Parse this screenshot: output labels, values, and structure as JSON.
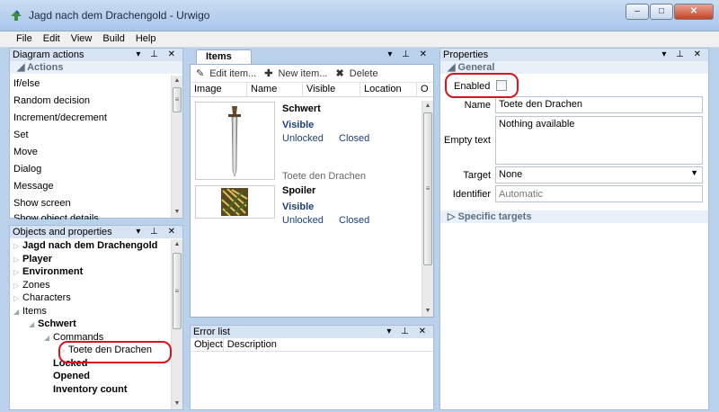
{
  "window": {
    "title": "Jagd nach dem Drachengold - Urwigo",
    "minimize": "–",
    "maximize": "□",
    "close": "✕"
  },
  "menu": [
    "File",
    "Edit",
    "View",
    "Build",
    "Help"
  ],
  "diagram_actions": {
    "title": "Diagram actions",
    "section": "Actions",
    "items": [
      "If/else",
      "Random decision",
      "Increment/decrement",
      "Set",
      "Move",
      "Dialog",
      "Message",
      "Show screen",
      "Show object details"
    ]
  },
  "objects": {
    "title": "Objects and properties",
    "tree": [
      {
        "label": "Jagd nach dem Drachengold",
        "bold": true,
        "indent": 0,
        "arrow": "▷"
      },
      {
        "label": "Player",
        "bold": true,
        "indent": 0,
        "arrow": "▷"
      },
      {
        "label": "Environment",
        "bold": true,
        "indent": 0,
        "arrow": "▷"
      },
      {
        "label": "Zones",
        "bold": false,
        "indent": 0,
        "arrow": "▷"
      },
      {
        "label": "Characters",
        "bold": false,
        "indent": 0,
        "arrow": "▷"
      },
      {
        "label": "Items",
        "bold": false,
        "indent": 0,
        "arrow": "◢"
      },
      {
        "label": "Schwert",
        "bold": true,
        "indent": 1,
        "arrow": "◢"
      },
      {
        "label": "Commands",
        "bold": false,
        "indent": 2,
        "arrow": "◢"
      },
      {
        "label": "Toete den Drachen",
        "bold": false,
        "indent": 3,
        "arrow": "▷"
      },
      {
        "label": "Locked",
        "bold": true,
        "indent": 2,
        "arrow": ""
      },
      {
        "label": "Opened",
        "bold": true,
        "indent": 2,
        "arrow": ""
      },
      {
        "label": "Inventory count",
        "bold": true,
        "indent": 2,
        "arrow": ""
      }
    ]
  },
  "items_panel": {
    "tab": "Items",
    "toolbar": {
      "edit": "Edit item...",
      "new": "New item...",
      "delete": "Delete"
    },
    "columns": [
      "Image",
      "Name",
      "Visible",
      "Location",
      "O"
    ],
    "items": [
      {
        "name": "Schwert",
        "visible": "Visible",
        "lock": "Unlocked",
        "state": "Closed",
        "command": "Toete den Drachen",
        "image": "sword"
      },
      {
        "name": "Spoiler",
        "visible": "Visible",
        "lock": "Unlocked",
        "state": "Closed",
        "command": "",
        "image": "spoiler"
      }
    ]
  },
  "error_list": {
    "title": "Error list",
    "columns": [
      "Object",
      "Description"
    ]
  },
  "properties": {
    "title": "Properties",
    "general": "General",
    "enabled_label": "Enabled",
    "enabled": false,
    "name_label": "Name",
    "name_value": "Toete den Drachen",
    "empty_text_label": "Empty text",
    "empty_text_value": "Nothing available",
    "target_label": "Target",
    "target_value": "None",
    "identifier_label": "Identifier",
    "identifier_placeholder": "Automatic",
    "specific_targets": "Specific targets"
  },
  "panel_controls": "▾ ⊥ ✕",
  "colors": {
    "highlight": "#d9141e",
    "panel_header": "#d6e3f3",
    "accent_text": "#1c3e7a"
  }
}
